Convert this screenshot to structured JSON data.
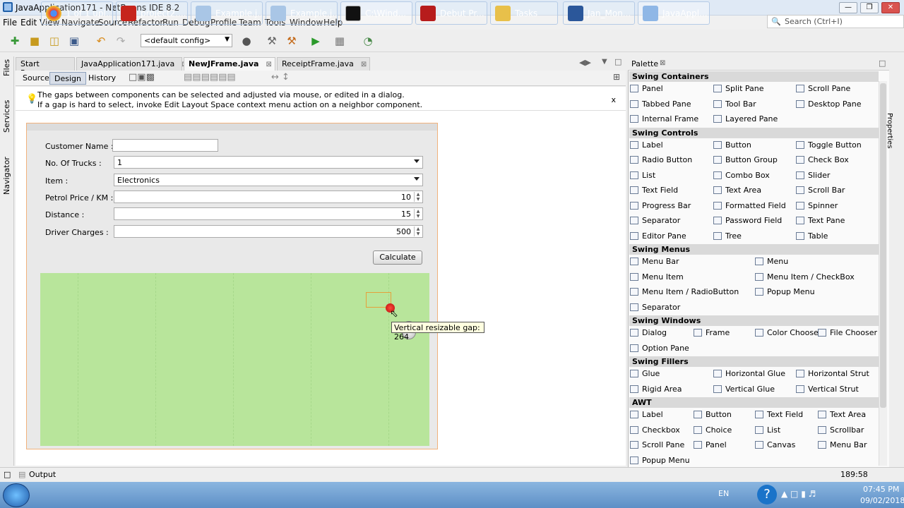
{
  "window": {
    "title": "JavaApplication171 - NetBeans IDE 8.2",
    "buttons": [
      "—",
      "❐",
      "✕"
    ]
  },
  "menu": [
    "File",
    "Edit",
    "View",
    "Navigate",
    "Source",
    "Refactor",
    "Run",
    "Debug",
    "Profile",
    "Team",
    "Tools",
    "Window",
    "Help"
  ],
  "search": {
    "placeholder": "Search (Ctrl+I)"
  },
  "toolbar": {
    "config": "<default config>"
  },
  "left_tabs": [
    "Files",
    "Services",
    "Navigator"
  ],
  "editor_tabs": [
    {
      "label": "Start Page",
      "active": false
    },
    {
      "label": "JavaApplication171.java",
      "active": false
    },
    {
      "label": "NewJFrame.java",
      "active": true
    },
    {
      "label": "ReceiptFrame.java",
      "active": false
    }
  ],
  "view_tabs": [
    "Source",
    "Design",
    "History"
  ],
  "hint": {
    "line1": "The gaps between components can be selected and adjusted via mouse, or edited in a dialog.",
    "line2": "If a gap is hard to select, invoke Edit Layout Space context menu action on a neighbor component.",
    "close": "x"
  },
  "form": {
    "customer_label": "Customer Name :",
    "trucks_label": "No. Of Trucks :",
    "trucks_value": "1",
    "item_label": "Item :",
    "item_value": "Electronics",
    "petrol_label": "Petrol Price / KM :",
    "petrol_value": "10",
    "distance_label": "Distance :",
    "distance_value": "15",
    "driver_label": "Driver Charges :",
    "driver_value": "500",
    "calculate": "Calculate"
  },
  "tooltip": "Vertical resizable gap: 264",
  "palette": {
    "title": "Palette",
    "categories": [
      {
        "name": "Swing Containers",
        "items": [
          "Panel",
          "Split Pane",
          "Scroll Pane",
          "Tabbed Pane",
          "Tool Bar",
          "Desktop Pane",
          "Internal Frame",
          "Layered Pane"
        ]
      },
      {
        "name": "Swing Controls",
        "items": [
          "Label",
          "Button",
          "Toggle Button",
          "Radio Button",
          "Button Group",
          "Check Box",
          "List",
          "Combo Box",
          "Slider",
          "Text Field",
          "Text Area",
          "Scroll Bar",
          "Progress Bar",
          "Formatted Field",
          "Spinner",
          "Separator",
          "Password Field",
          "Text Pane",
          "Editor Pane",
          "Tree",
          "Table"
        ]
      },
      {
        "name": "Swing Menus",
        "items": [
          "Menu Bar",
          "Menu",
          "Menu Item",
          "Menu Item / CheckBox",
          "Menu Item / RadioButton",
          "Popup Menu",
          "Separator"
        ]
      },
      {
        "name": "Swing Windows",
        "items": [
          "Dialog",
          "Frame",
          "Color Chooser",
          "File Chooser",
          "Option Pane"
        ]
      },
      {
        "name": "Swing Fillers",
        "items": [
          "Glue",
          "Horizontal Glue",
          "Horizontal Strut",
          "Rigid Area",
          "Vertical Glue",
          "Vertical Strut"
        ]
      },
      {
        "name": "AWT",
        "items": [
          "Label",
          "Button",
          "Text Field",
          "Text Area",
          "Checkbox",
          "Choice",
          "List",
          "Scrollbar",
          "Scroll Pane",
          "Panel",
          "Canvas",
          "Menu Bar",
          "Popup Menu"
        ]
      }
    ]
  },
  "right_tabs": [
    "Properties"
  ],
  "output": {
    "label": "Output",
    "position": "189:58"
  },
  "taskbar": {
    "tasks": [
      "1 of 1 upl...",
      "project2....",
      "Example.j...",
      "Example.j...",
      "C:\\Wind...",
      "Debut Pr...",
      "Tasks",
      "Jan_Mon...",
      "JavaAppl..."
    ],
    "lang": "EN",
    "time": "07:45 PM",
    "date": "09/02/2018"
  },
  "colors": {
    "design_area": "#b8e59b",
    "selection": "#e5a03b",
    "tooltip_bg": "#ffffe0"
  }
}
